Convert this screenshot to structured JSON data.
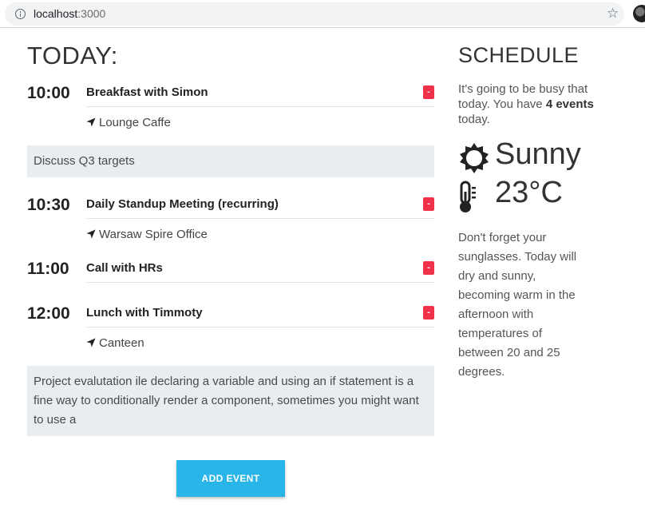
{
  "browser": {
    "url_host": "localhost",
    "url_port": ":3000",
    "info_icon": "info-icon",
    "star_icon": "star-icon"
  },
  "today": {
    "title": "TODAY:"
  },
  "events": [
    {
      "time": "10:00",
      "title": "Breakfast with Simon",
      "location": "Lounge Caffe",
      "remove_label": "-"
    },
    {
      "time": "10:30",
      "title": "Daily Standup Meeting (recurring)",
      "location": "Warsaw Spire Office",
      "remove_label": "-"
    },
    {
      "time": "11:00",
      "title": "Call with HRs",
      "remove_label": "-"
    },
    {
      "time": "12:00",
      "title": "Lunch with Timmoty",
      "location": "Canteen",
      "remove_label": "-"
    }
  ],
  "notes": [
    "Discuss Q3 targets",
    "Project evalutation ile declaring a variable and using an if statement is a fine way to conditionally render a component, sometimes you might want to use a"
  ],
  "add_event_label": "ADD EVENT",
  "schedule": {
    "title": "SCHEDULE",
    "summary_prefix": "It's going to be busy that today. You have",
    "event_count": "4 events",
    "summary_suffix": "today.",
    "weather": "Sunny",
    "weather_icon": "sun-icon",
    "temperature": "23°C",
    "temperature_icon": "thermometer-icon",
    "forecast": "Don't forget your sunglasses. Today will dry and sunny, becoming warm in the afternoon with temperatures of between 20 and 25 degrees."
  },
  "colors": {
    "remove_button": "#f0314a",
    "add_button": "#29b5e8",
    "note_background": "#e9edf0"
  }
}
